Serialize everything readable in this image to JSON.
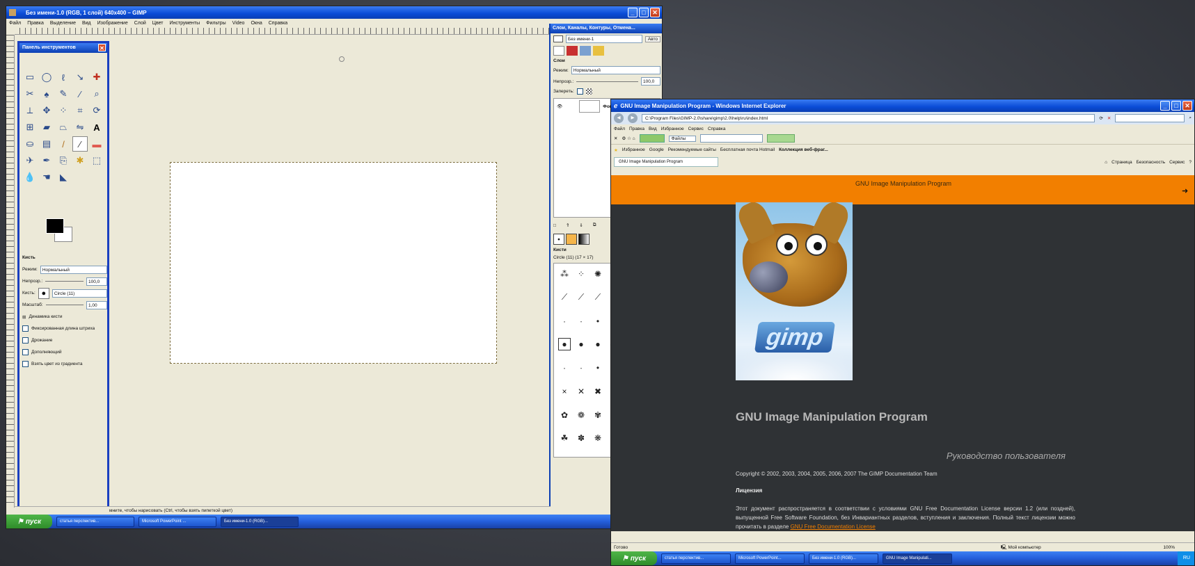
{
  "gimp": {
    "window_title": "Без имени-1.0 (RGB, 1 слой) 640x400 – GIMP",
    "menu": [
      "Файл",
      "Правка",
      "Выделение",
      "Вид",
      "Изображение",
      "Слой",
      "Цвет",
      "Инструменты",
      "Фильтры",
      "Video",
      "Окна",
      "Справка"
    ],
    "status_hint": "мните, чтобы нарисовать (Ctrl, чтобы взять пипеткой цвет)",
    "toolbox": {
      "title": "Панель инструментов",
      "tool_options_title": "Кисть",
      "mode_label": "Режим:",
      "mode_value": "Нормальный",
      "opacity_label": "Непрозр.:",
      "opacity_value": "100,0",
      "brush_label": "Кисть:",
      "brush_value": "Circle (11)",
      "scale_label": "Масштаб:",
      "scale_value": "1,00",
      "dynamics_label": "Динамика кисти",
      "checks": [
        "Фиксированная длина штриха",
        "Дрожание",
        "Дополняющий",
        "Взять цвет из градиента"
      ]
    },
    "dock": {
      "title": "Слои, Каналы, Контуры, Отмена...",
      "image_select": "Без имени-1",
      "auto_button": "Авто",
      "layers_label": "Слои",
      "mode_label": "Режим:",
      "mode_value": "Нормальный",
      "opacity_label": "Непрозр.:",
      "opacity_value": "100,0",
      "lock_label": "Запереть:",
      "layer_name": "Фон",
      "brushes_label": "Кисти",
      "brush_current": "Circle (11) (17 × 17)"
    },
    "taskbar": {
      "start": "пуск",
      "tasks": [
        "статья перспектив...",
        "Microsoft PowerPoint ...",
        "Без имени-1.0 (RGB)..."
      ]
    }
  },
  "ie": {
    "window_title": "GNU Image Manipulation Program - Windows Internet Explorer",
    "address": "C:\\Program Files\\GIMP-2.0\\share\\gimp\\2.0\\help\\ru\\index.html",
    "menu": [
      "Файл",
      "Правка",
      "Вид",
      "Избранное",
      "Сервис",
      "Справка"
    ],
    "search_label": "Файлы",
    "favorites_label": "Избранное",
    "fav_links": [
      "Google",
      "Рекомендуемые сайты",
      "Бесплатная почта Hotmail",
      "Коллекция веб-фраг..."
    ],
    "tab_title": "GNU Image Manipulation Program",
    "right_tools": [
      "Страница",
      "Безопасность",
      "Сервис"
    ],
    "page": {
      "banner": "GNU Image Manipulation Program",
      "heading": "GNU Image Manipulation Program",
      "subtitle": "Руководство пользователя",
      "copyright": "Copyright © 2002, 2003, 2004, 2005, 2006, 2007 The GIMP Documentation Team",
      "license_heading": "Лицензия",
      "license_text": "Этот документ распространяется в соответствии с условиями GNU Free Documentation License версии 1.2 (или поздней), выпущенной Free Software Foundation, без Инвариантных разделов, вступления и заключения. Полный текст лицензии можно прочитать в разделе ",
      "license_link": "GNU Free Documentation License"
    },
    "status": {
      "left": "Готово",
      "zone": "Мой компьютер",
      "zoom": "100%"
    },
    "taskbar": {
      "start": "пуск",
      "tasks": [
        "статья перспектив...",
        "Microsoft PowerPoint...",
        "Без имени-1.0 (RGB)...",
        "GNU Image Manipulati..."
      ],
      "tray": "RU"
    }
  },
  "colors": {
    "xp_blue": "#0a4bd6",
    "gimp_orange": "#f27f00",
    "page_dark": "#2f3235"
  }
}
